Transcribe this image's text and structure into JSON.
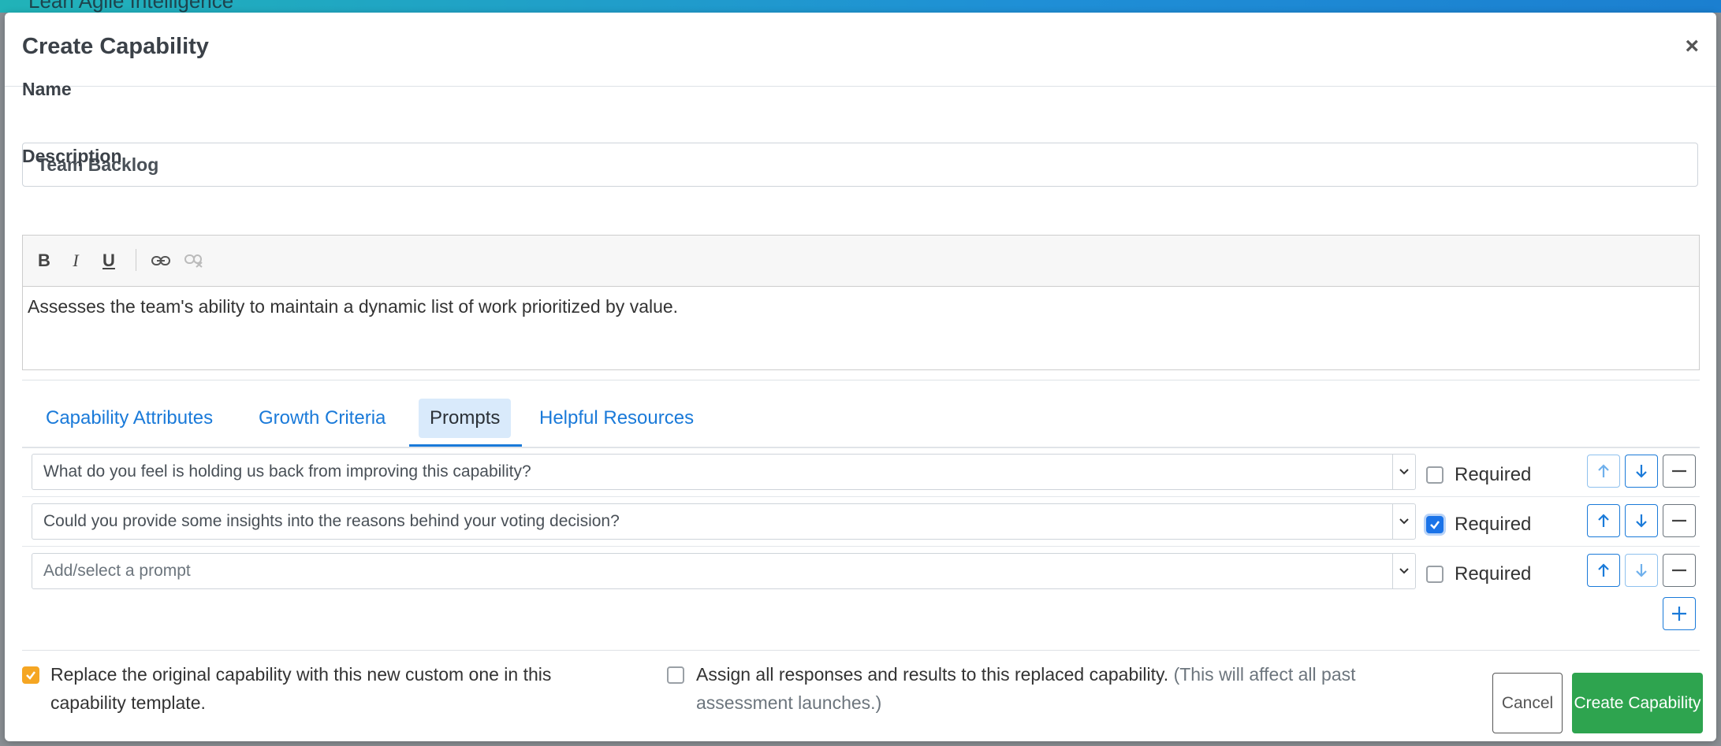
{
  "backdrop": {
    "title": "Lean Agile Intelligence"
  },
  "modal": {
    "title": "Create Capability",
    "close_symbol": "×"
  },
  "name_field": {
    "label": "Name",
    "value": "Team Backlog"
  },
  "description": {
    "label": "Description",
    "toolbar": {
      "bold": "B",
      "italic": "I",
      "underline": "U"
    },
    "text": "Assesses the team's ability to maintain a dynamic list of work prioritized by value."
  },
  "tabs": [
    {
      "label": "Capability Attributes",
      "active": false
    },
    {
      "label": "Growth Criteria",
      "active": false
    },
    {
      "label": "Prompts",
      "active": true
    },
    {
      "label": "Helpful Resources",
      "active": false
    }
  ],
  "prompts": [
    {
      "text": "What do you feel is holding us back from improving this capability?",
      "required": false,
      "required_label": "Required"
    },
    {
      "text": "Could you provide some insights into the reasons behind your voting decision?",
      "required": true,
      "required_label": "Required"
    },
    {
      "placeholder": "Add/select a prompt",
      "required": false,
      "required_label": "Required"
    }
  ],
  "footer": {
    "replace_label": "Replace the original capability with this new custom one in this capability template.",
    "replace_checked": true,
    "assign_label": "Assign all responses and results to this replaced capability.",
    "assign_note": "(This will affect all past assessment launches.)",
    "assign_checked": false,
    "cancel_label": "Cancel",
    "create_label": "Create Capability"
  },
  "colors": {
    "accent": "#1a7ad9",
    "success": "#2ea44f",
    "warning": "#f5a623"
  }
}
